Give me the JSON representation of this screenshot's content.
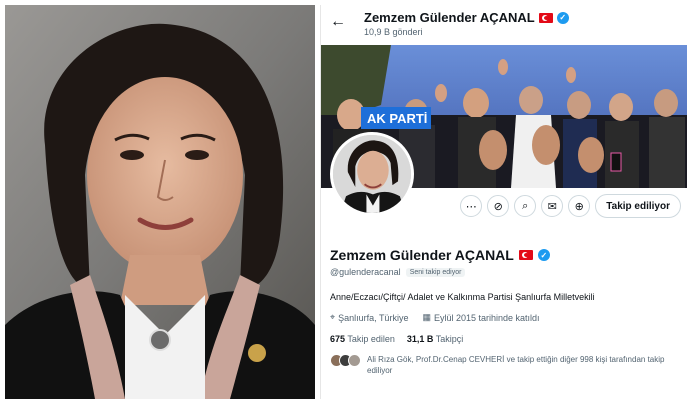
{
  "header": {
    "name": "Zemzem Gülender AÇANAL",
    "posts_count": "10,9 B gönderi"
  },
  "profile": {
    "name": "Zemzem Gülender AÇANAL",
    "handle": "@gulenderacanal",
    "follows_you_badge": "Seni takip ediyor",
    "bio": "Anne/Eczacı/Çiftçi/ Adalet ve Kalkınma Partisi Şanlıurfa Milletvekili",
    "location": "Şanlıurfa, Türkiye",
    "joined": "Eylül 2015 tarihinde katıldı",
    "following_count": "675",
    "following_label": "Takip edilen",
    "followers_count": "31,1 B",
    "followers_label": "Takipçi",
    "known_followers_text": "Ali Rıza Gök, Prof.Dr.Cenap CEVHERİ ve takip ettiğin diğer 998 kişi tarafından takip ediliyor"
  },
  "actions": {
    "follow_label": "Takip ediliyor",
    "icons": [
      "more-icon",
      "grok-icon",
      "search-icon",
      "message-icon",
      "notify-icon"
    ]
  },
  "banner": {
    "sign_text": "AK PARTİ"
  },
  "colors": {
    "accent_blue": "#1d9bf0",
    "flag_red": "#e30a17",
    "muted_text": "#536471"
  }
}
